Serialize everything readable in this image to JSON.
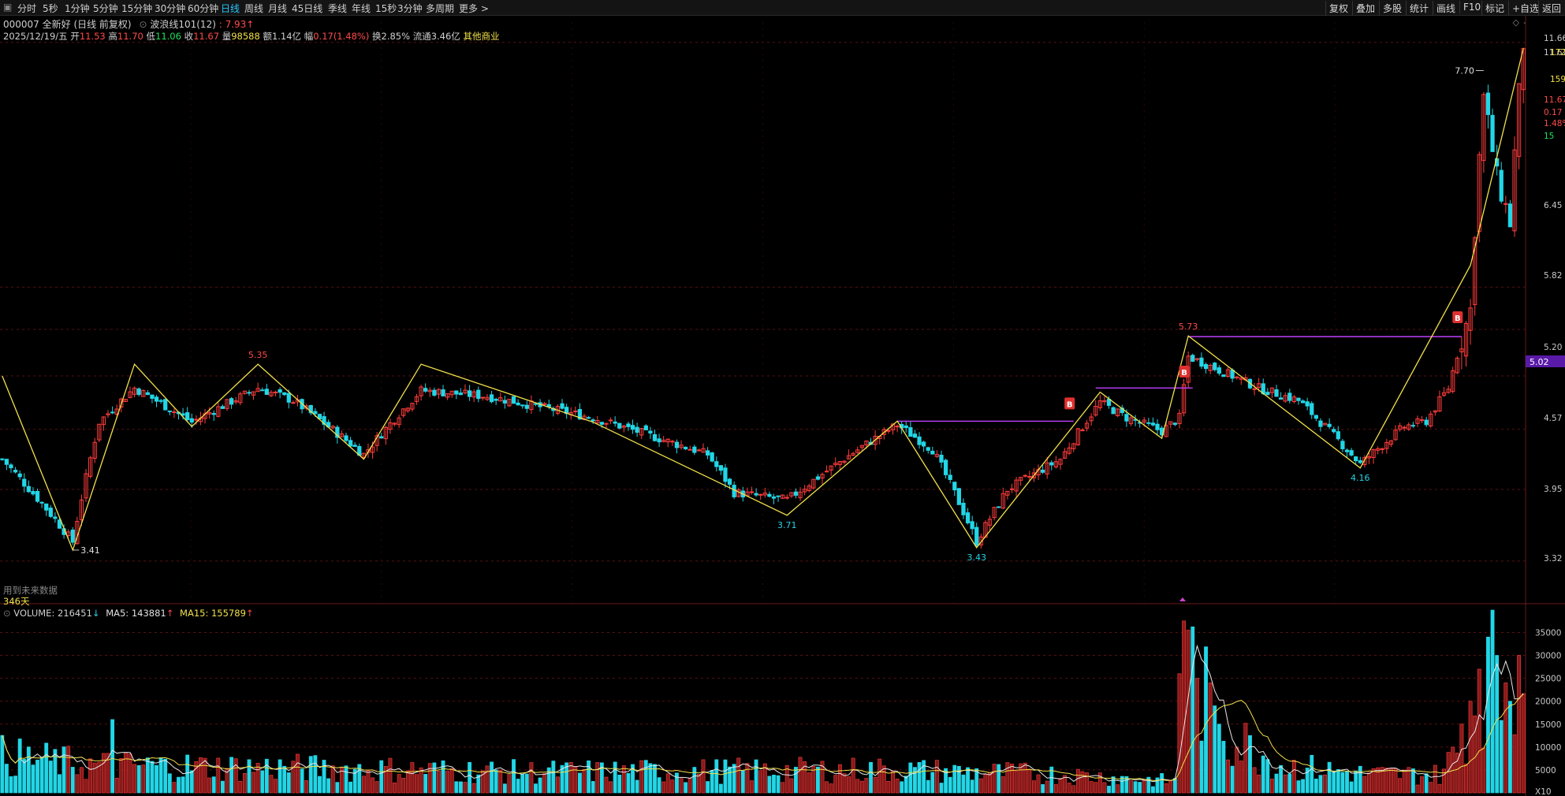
{
  "toolbar": {
    "timeframes": [
      "分时",
      "5秒",
      "1分钟",
      "5分钟",
      "15分钟",
      "30分钟",
      "60分钟",
      "日线",
      "周线",
      "月线",
      "45日线",
      "季线",
      "年线",
      "15秒",
      "3分钟",
      "多周期",
      "更多 >"
    ],
    "active_index": 7,
    "right_buttons": [
      "复权",
      "叠加",
      "多股",
      "统计",
      "画线",
      "F10",
      "标记",
      "+自选",
      "返回"
    ]
  },
  "header": {
    "stock": "000007 全新好 (日线 前复权)",
    "indicator": "波浪线101(12)",
    "indicator_value": ": 7.93",
    "date": "2025/12/19/五",
    "open_label": "开",
    "open": "11.53",
    "high_label": "高",
    "high": "11.70",
    "low_label": "低",
    "low": "11.06",
    "close_label": "收",
    "close": "11.67",
    "volume_label": "量",
    "volume": "98588",
    "amount_label": "额",
    "amount": "1.14亿",
    "change_label": "幅",
    "change": "0.17(1.48%)",
    "turnover_label": "换",
    "turnover": "2.85%",
    "float_label": "流通",
    "float": "3.46亿",
    "industry": "其他商业"
  },
  "main_notes": {
    "future_data": "用到未来数据",
    "days": "346天"
  },
  "volume_header": {
    "name": "VOLUME: 216451",
    "ma5": "MA5: 143881",
    "ma15": "MA15: 155789"
  },
  "right_axis": {
    "price_ticks": [
      "11.66",
      "11.67",
      "6.45",
      "5.82",
      "5.20",
      "4.57",
      "3.95",
      "3.32"
    ],
    "quote_labels": [
      "172",
      "159",
      "11.67",
      "0.17",
      "1.48%",
      "15"
    ],
    "current_price": "5.02",
    "volume_ticks": [
      "35000",
      "30000",
      "25000",
      "20000",
      "15000",
      "10000",
      "5000",
      "X10"
    ]
  },
  "colors": {
    "up": "#ff3c3c",
    "down": "#22d6e6",
    "wave": "#f2e14a",
    "level": "#c040ff",
    "bg": "#000000",
    "grid": "#5a1010"
  },
  "chart_data": {
    "type": "candlestick",
    "price_axis": {
      "min": 3.0,
      "max": 11.8,
      "scale": "log",
      "ticks": [
        3.32,
        3.95,
        4.57,
        5.2,
        5.82,
        6.45,
        11.67
      ]
    },
    "volume_axis": {
      "min": 0,
      "max": 38000,
      "ticks": [
        5000,
        10000,
        15000,
        20000,
        25000,
        30000,
        35000
      ]
    },
    "bars": 346,
    "wave_points": [
      {
        "i": 0,
        "p": 5.2
      },
      {
        "i": 16,
        "p": 3.41
      },
      {
        "i": 30,
        "p": 5.35
      },
      {
        "i": 43,
        "p": 4.6
      },
      {
        "i": 58,
        "p": 5.35
      },
      {
        "i": 82,
        "p": 4.25
      },
      {
        "i": 95,
        "p": 5.35
      },
      {
        "i": 134,
        "p": 4.65
      },
      {
        "i": 178,
        "p": 3.71
      },
      {
        "i": 203,
        "p": 4.66
      },
      {
        "i": 221,
        "p": 3.43
      },
      {
        "i": 249,
        "p": 5.0
      },
      {
        "i": 263,
        "p": 4.47
      },
      {
        "i": 269,
        "p": 5.73
      },
      {
        "i": 308,
        "p": 4.16
      },
      {
        "i": 333,
        "p": 6.8
      },
      {
        "i": 345,
        "p": 11.5
      }
    ],
    "anchors": [
      {
        "i": 0,
        "c": 4.25
      },
      {
        "i": 16,
        "c": 3.48
      },
      {
        "i": 22,
        "c": 4.65
      },
      {
        "i": 30,
        "c": 5.05
      },
      {
        "i": 43,
        "c": 4.65
      },
      {
        "i": 58,
        "c": 5.05
      },
      {
        "i": 66,
        "c": 4.9
      },
      {
        "i": 82,
        "c": 4.3
      },
      {
        "i": 95,
        "c": 5.02
      },
      {
        "i": 110,
        "c": 4.95
      },
      {
        "i": 134,
        "c": 4.7
      },
      {
        "i": 160,
        "c": 4.3
      },
      {
        "i": 166,
        "c": 3.92
      },
      {
        "i": 178,
        "c": 3.85
      },
      {
        "i": 195,
        "c": 4.38
      },
      {
        "i": 203,
        "c": 4.62
      },
      {
        "i": 211,
        "c": 4.35
      },
      {
        "i": 221,
        "c": 3.48
      },
      {
        "i": 228,
        "c": 3.95
      },
      {
        "i": 240,
        "c": 4.25
      },
      {
        "i": 249,
        "c": 4.88
      },
      {
        "i": 255,
        "c": 4.7
      },
      {
        "i": 263,
        "c": 4.55
      },
      {
        "i": 267,
        "c": 4.7
      },
      {
        "i": 269,
        "c": 5.45
      },
      {
        "i": 285,
        "c": 5.05
      },
      {
        "i": 294,
        "c": 4.9
      },
      {
        "i": 308,
        "c": 4.2
      },
      {
        "i": 318,
        "c": 4.6
      },
      {
        "i": 323,
        "c": 4.66
      },
      {
        "i": 328,
        "c": 5.05
      },
      {
        "i": 333,
        "c": 6.1
      },
      {
        "i": 336,
        "c": 10.2
      },
      {
        "i": 339,
        "c": 8.4
      },
      {
        "i": 342,
        "c": 7.55
      },
      {
        "i": 345,
        "c": 11.67
      }
    ],
    "volume_anchors": [
      {
        "i": 0,
        "v": 8000
      },
      {
        "i": 20,
        "v": 6000
      },
      {
        "i": 60,
        "v": 5500
      },
      {
        "i": 120,
        "v": 4500
      },
      {
        "i": 200,
        "v": 5000
      },
      {
        "i": 240,
        "v": 4000
      },
      {
        "i": 266,
        "v": 2500
      },
      {
        "i": 268,
        "v": 30000
      },
      {
        "i": 272,
        "v": 22000
      },
      {
        "i": 278,
        "v": 13000
      },
      {
        "i": 290,
        "v": 6000
      },
      {
        "i": 310,
        "v": 4000
      },
      {
        "i": 326,
        "v": 4000
      },
      {
        "i": 330,
        "v": 9000
      },
      {
        "i": 334,
        "v": 22000
      },
      {
        "i": 338,
        "v": 26000
      },
      {
        "i": 342,
        "v": 20000
      },
      {
        "i": 345,
        "v": 24000
      }
    ],
    "volume_spikes": [
      {
        "i": 25,
        "v": 16000
      },
      {
        "i": 268,
        "v": 37500
      },
      {
        "i": 269,
        "v": 35500
      },
      {
        "i": 267,
        "v": 26000
      },
      {
        "i": 271,
        "v": 25000
      },
      {
        "i": 274,
        "v": 24000
      },
      {
        "i": 276,
        "v": 15000
      },
      {
        "i": 280,
        "v": 10000
      },
      {
        "i": 331,
        "v": 15000
      },
      {
        "i": 333,
        "v": 20000
      },
      {
        "i": 335,
        "v": 27000
      },
      {
        "i": 337,
        "v": 34000
      },
      {
        "i": 339,
        "v": 30000
      },
      {
        "i": 341,
        "v": 24000
      },
      {
        "i": 342,
        "v": 20000
      },
      {
        "i": 344,
        "v": 30000
      },
      {
        "i": 345,
        "v": 21645
      }
    ],
    "labels": [
      {
        "i": 16,
        "p": 3.41,
        "text": "3.41",
        "color": "#e0e0e0",
        "side": "right"
      },
      {
        "i": 58,
        "p": 5.35,
        "text": "5.35",
        "color": "#ff4a4a",
        "side": "top"
      },
      {
        "i": 178,
        "p": 3.71,
        "text": "3.71",
        "color": "#22d6e6",
        "side": "bottom"
      },
      {
        "i": 221,
        "p": 3.43,
        "text": "3.43",
        "color": "#22d6e6",
        "side": "bottom"
      },
      {
        "i": 269,
        "p": 5.73,
        "text": "5.73",
        "color": "#ff4a4a",
        "side": "top"
      },
      {
        "i": 308,
        "p": 4.16,
        "text": "4.16",
        "color": "#22d6e6",
        "side": "bottom"
      },
      {
        "i": 336,
        "p": 10.9,
        "text": "7.70",
        "color": "#e0e0e0",
        "side": "left"
      }
    ],
    "levels": [
      {
        "from": 203,
        "to": 243,
        "p": 4.66
      },
      {
        "from": 248,
        "to": 270,
        "p": 5.05
      },
      {
        "from": 269,
        "to": 331,
        "p": 5.72
      }
    ],
    "signals": [
      {
        "i": 242,
        "p": 4.86,
        "text": "B"
      },
      {
        "i": 268,
        "p": 5.25,
        "text": "B"
      },
      {
        "i": 330,
        "p": 5.99,
        "text": "B"
      }
    ]
  }
}
